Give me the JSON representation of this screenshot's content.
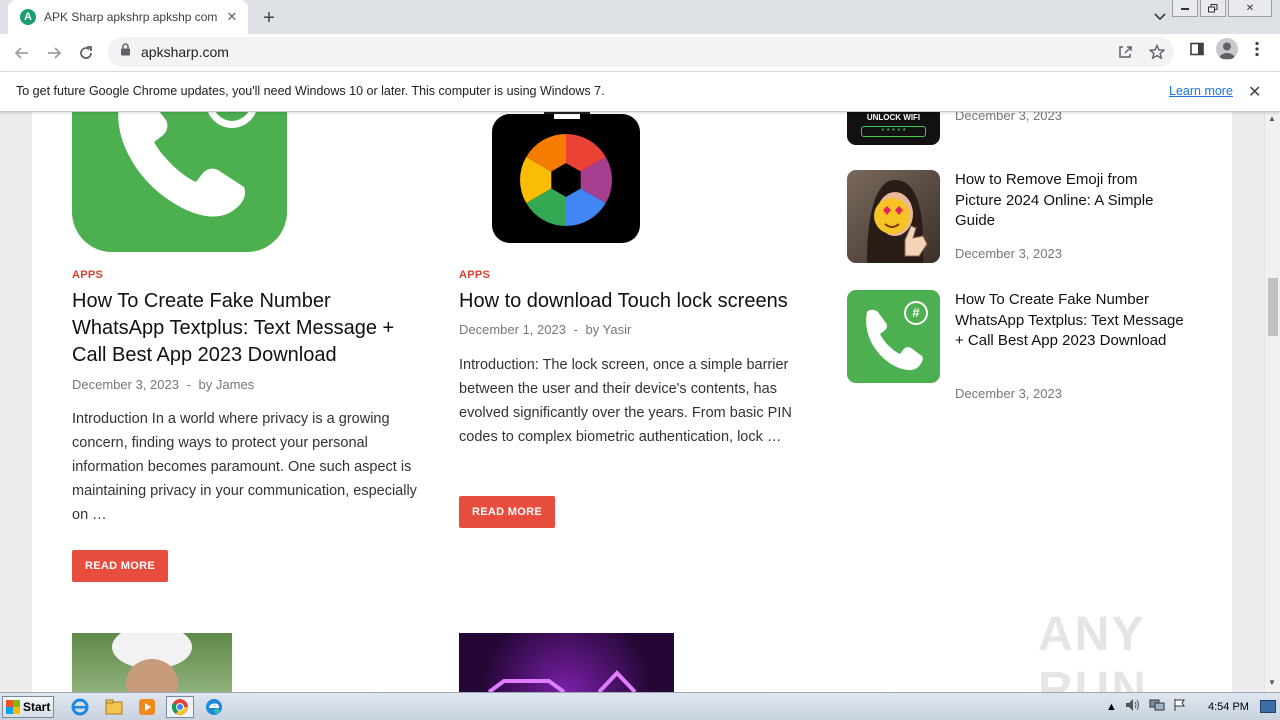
{
  "browser": {
    "tab_title": "APK Sharp apkshrp apkshp com - Yo",
    "new_tab_symbol": "+",
    "url": "apksharp.com",
    "infobar_text": "To get future Google Chrome updates, you'll need Windows 10 or later. This computer is using Windows 7.",
    "infobar_link": "Learn more"
  },
  "posts": [
    {
      "category": "APPS",
      "title": "How To Create Fake Number WhatsApp Textplus: Text Message + Call Best App 2023 Download",
      "date": "December 3, 2023",
      "author_prefix": "by",
      "author": "James",
      "excerpt": "Introduction In a world where privacy is a growing concern, finding ways to protect your personal information becomes paramount. One such aspect is maintaining privacy in your communication, especially on …",
      "read_more": "READ MORE"
    },
    {
      "category": "APPS",
      "title": "How to download Touch lock screens",
      "date": "December 1, 2023",
      "author_prefix": "by",
      "author": "Yasir",
      "excerpt": "Introduction: The lock screen, once a simple barrier between the user and their device's contents, has evolved significantly over the years. From basic PIN codes to complex biometric authentication, lock …",
      "read_more": "READ MORE"
    }
  ],
  "sidebar": {
    "items": [
      {
        "thumb_text": "UNLOCK WIFI",
        "thumb_dots": "* * * * *",
        "title": "",
        "date": "December 3, 2023"
      },
      {
        "title": "How to Remove Emoji from Picture 2024 Online: A Simple Guide",
        "date": "December 3, 2023"
      },
      {
        "title": "How To Create Fake Number WhatsApp Textplus: Text Message + Call Best App 2023 Download",
        "date": "December 3, 2023",
        "badge": "#"
      }
    ]
  },
  "watermark": "ANY RUN",
  "taskbar": {
    "start_label": "Start",
    "clock": "4:54 PM"
  },
  "colors": {
    "accent_red": "#e74c3c",
    "category_red": "#d9402b",
    "whatsapp_green": "#4caf50"
  }
}
